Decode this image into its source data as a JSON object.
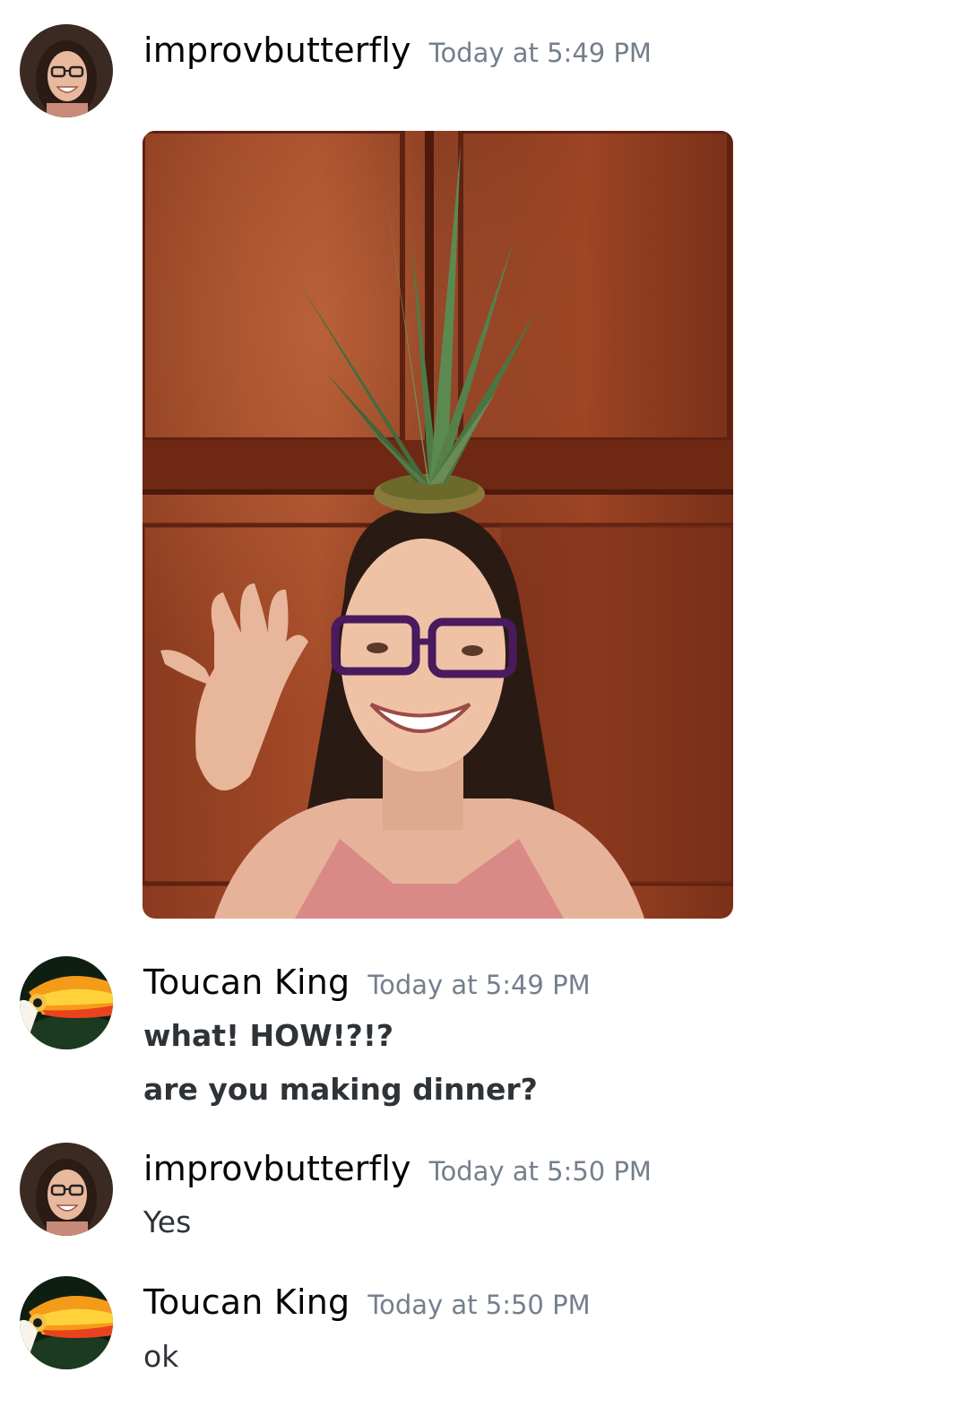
{
  "messages": [
    {
      "author": "improvbutterfly",
      "timestamp": "Today at 5:49 PM",
      "avatar": "woman-glasses-avatar",
      "attachment": {
        "type": "image",
        "icon": "photo-woman-pineapple-on-head"
      }
    },
    {
      "author": "Toucan King",
      "timestamp": "Today at 5:49 PM",
      "avatar": "toucan-avatar",
      "lines": [
        "what! HOW!?!?",
        "are you making dinner?"
      ]
    },
    {
      "author": "improvbutterfly",
      "timestamp": "Today at 5:50 PM",
      "avatar": "woman-glasses-avatar",
      "lines": [
        "Yes"
      ]
    },
    {
      "author": "Toucan King",
      "timestamp": "Today at 5:50 PM",
      "avatar": "toucan-avatar",
      "lines": [
        "ok"
      ]
    }
  ],
  "colors": {
    "username": "#060607",
    "timestamp": "#747f8d",
    "text": "#2e3338",
    "background": "#ffffff"
  }
}
